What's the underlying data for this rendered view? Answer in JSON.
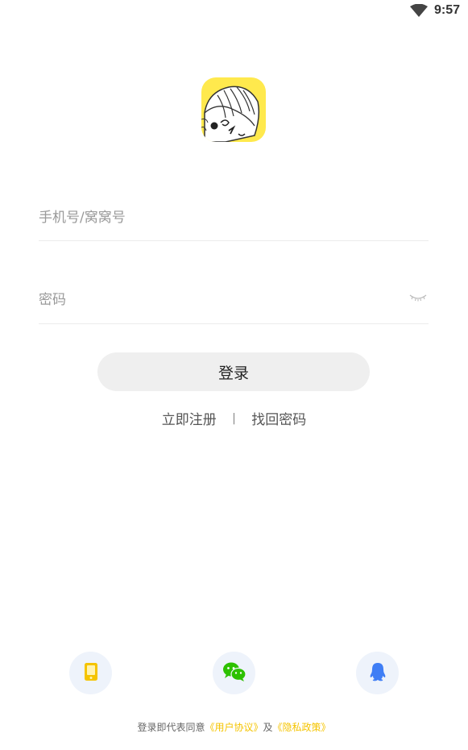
{
  "status_bar": {
    "time": "9:57",
    "wifi_icon": "wifi-icon"
  },
  "logo": {
    "icon": "app-logo-icon",
    "background": "#ffe94d"
  },
  "login_form": {
    "phone_placeholder": "手机号/窝窝号",
    "password_placeholder": "密码",
    "password_visibility_icon": "eye-closed-icon",
    "login_label": "登录"
  },
  "links": {
    "register": "立即注册",
    "separator": "|",
    "forgot_password": "找回密码"
  },
  "social_login": [
    {
      "icon": "phone-icon",
      "color": "#f5c400"
    },
    {
      "icon": "wechat-icon",
      "color": "#2dc100"
    },
    {
      "icon": "qq-icon",
      "color": "#3f7ef5"
    }
  ],
  "agreement": {
    "prefix": "登录即代表同意",
    "user_agreement": "《用户协议》",
    "and": "及",
    "privacy_policy": "《隐私政策》"
  },
  "colors": {
    "accent": "#f5c400",
    "button_bg": "#efefef"
  }
}
